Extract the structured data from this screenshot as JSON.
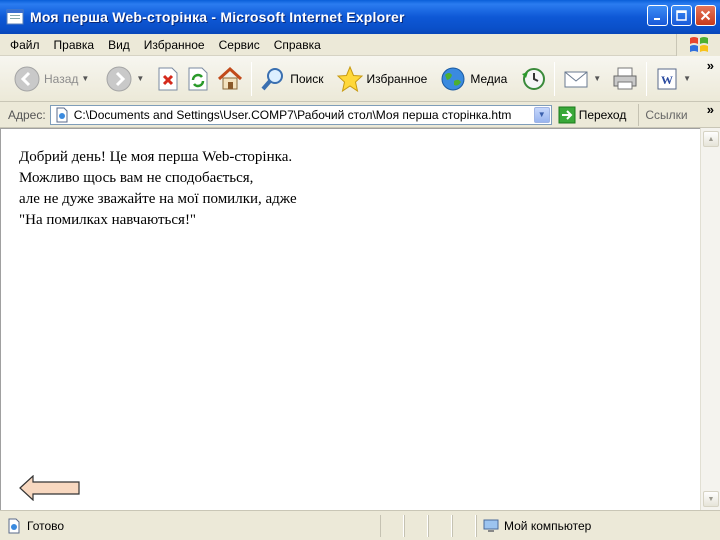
{
  "window": {
    "title": "Моя перша Web-сторінка - Microsoft Internet Explorer"
  },
  "menu": {
    "items": [
      "Файл",
      "Правка",
      "Вид",
      "Избранное",
      "Сервис",
      "Справка"
    ]
  },
  "toolbar": {
    "back_label": "Назад",
    "search_label": "Поиск",
    "favorites_label": "Избранное",
    "media_label": "Медиа",
    "chevron": "»"
  },
  "address": {
    "label": "Адрес:",
    "value": "C:\\Documents and Settings\\User.COMP7\\Рабочий стол\\Моя перша сторінка.htm",
    "go_label": "Переход",
    "links_label": "Ссылки",
    "chevron": "»"
  },
  "page": {
    "lines": [
      "Добрий день! Це моя перша Web-сторінка.",
      "Можливо щось вам не сподобається,",
      "але не дуже зважайте на мої помилки, адже",
      "\"На помилках навчаються!\""
    ]
  },
  "status": {
    "text": "Готово",
    "zone": "Мой компьютер"
  },
  "colors": {
    "titlebar": "#0e58d6",
    "chrome": "#ece9d8",
    "arrow_fill": "#f8d8c0"
  }
}
